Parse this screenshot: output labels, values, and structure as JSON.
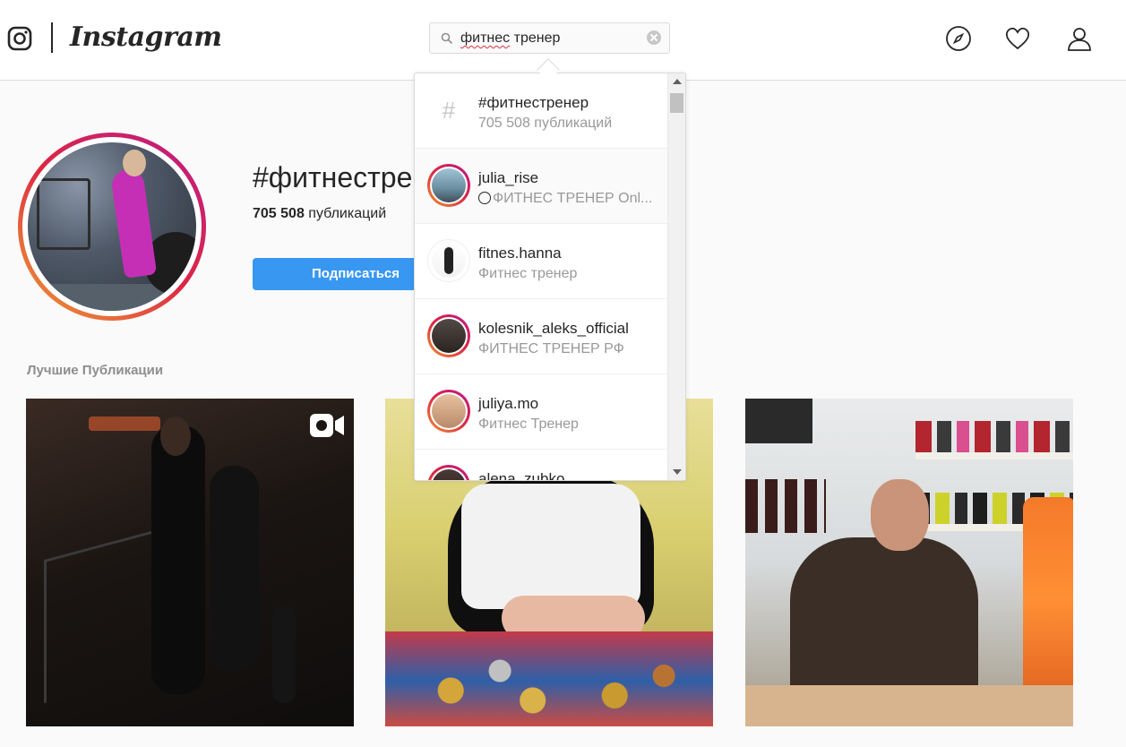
{
  "header": {
    "wordmark": "Instagram",
    "search": {
      "value_prefix": "фитнес",
      "value_suffix": " тренер"
    },
    "icons": [
      "instagram-glyph-icon",
      "explore-compass-icon",
      "heart-icon",
      "profile-icon"
    ]
  },
  "hashtag": {
    "title": "#фитнестре",
    "post_count_number": "705 508",
    "post_count_label": " публикаций",
    "follow_label": "Подписаться"
  },
  "top_posts": {
    "title": "Лучшие Публикации"
  },
  "search_results": [
    {
      "name": "#фитнестренер",
      "subtitle": "705 508 публикаций",
      "type": "hashtag"
    },
    {
      "name": "julia_rise",
      "subtitle": "ФИТНЕС ТРЕНЕР Onl...",
      "type": "user",
      "has_story": true
    },
    {
      "name": "fitnes.hanna",
      "subtitle": "Фитнес тренер",
      "type": "user",
      "has_story": false
    },
    {
      "name": "kolesnik_aleks_official",
      "subtitle": "ФИТНЕС ТРЕНЕР РФ",
      "type": "user",
      "has_story": true
    },
    {
      "name": "juliya.mo",
      "subtitle": "Фитнес Тренер",
      "type": "user",
      "has_story": true
    },
    {
      "name": "alena_zubko",
      "subtitle": "",
      "type": "user",
      "has_story": true
    }
  ],
  "colors": {
    "accent": "#3897f0",
    "border": "#dbdbdb",
    "muted_text": "#999999",
    "story_ring_start": "#f09433",
    "story_ring_end": "#bc1888"
  }
}
